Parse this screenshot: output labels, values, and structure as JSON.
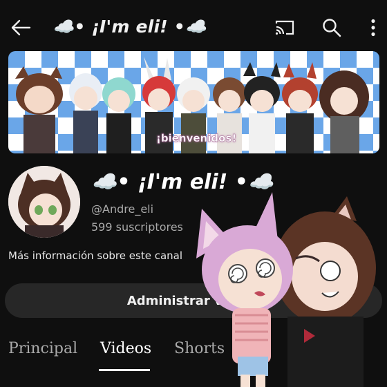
{
  "topbar": {
    "title": "☁️• ¡I'm eli! •☁️",
    "icons": [
      "back-arrow-icon",
      "cast-icon",
      "search-icon",
      "more-vert-icon"
    ]
  },
  "banner": {
    "caption": "¡bienvenidos!"
  },
  "channel": {
    "name": "☁️• ¡I'm eli! •☁️",
    "handle": "@Andre_eli",
    "subscribers": "599 suscriptores",
    "more_info": "Más información sobre este canal"
  },
  "actions": {
    "manage_label": "Administrar videos"
  },
  "tabs": [
    {
      "label": "Principal"
    },
    {
      "label": "Videos"
    },
    {
      "label": "Shorts"
    }
  ],
  "active_tab": "Videos",
  "colors": {
    "background": "#0f0f0f",
    "button": "#272727",
    "secondary_text": "#aaaaaa",
    "banner_checker": "#6aa6e8"
  }
}
